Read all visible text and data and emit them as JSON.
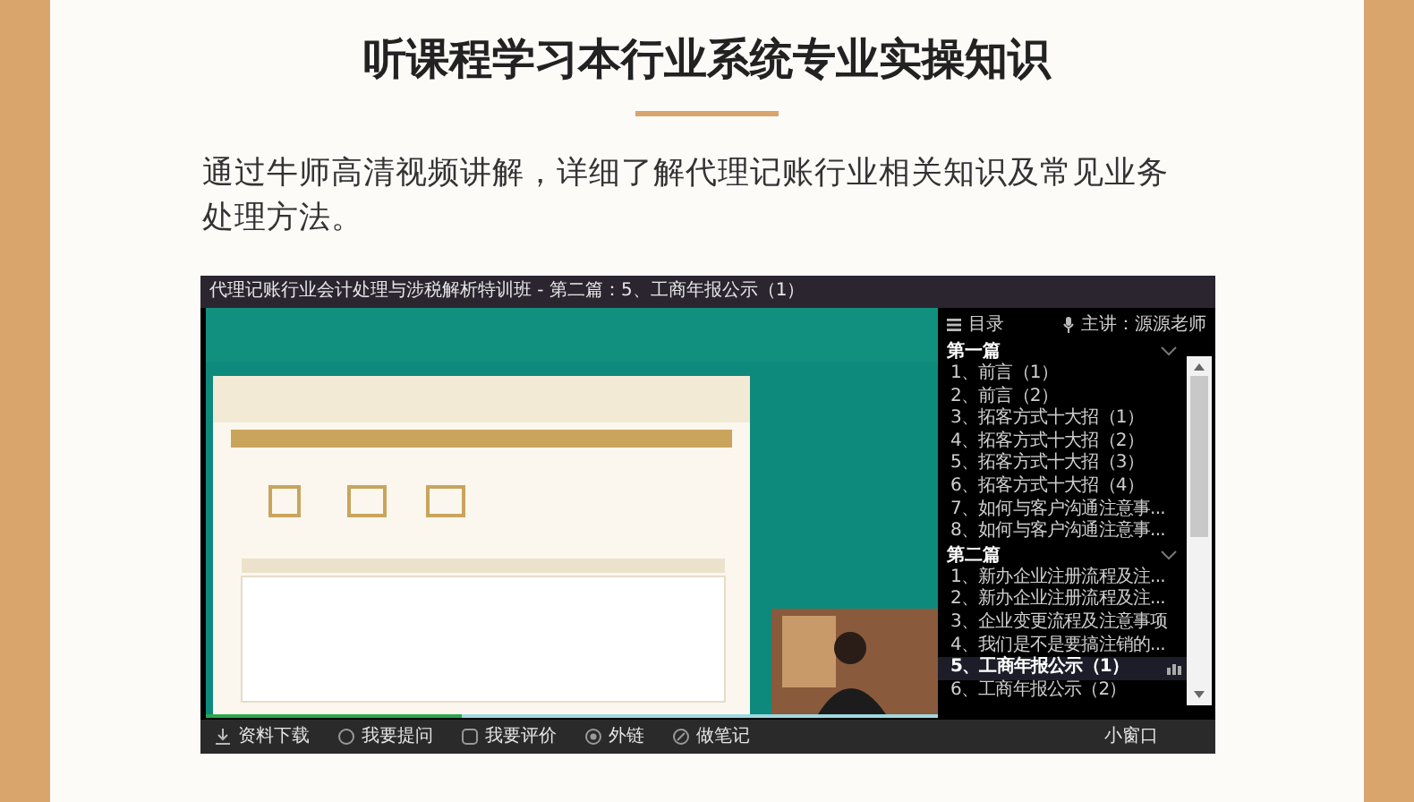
{
  "heading": "听课程学习本行业系统专业实操知识",
  "intro": "通过牛师高清视频讲解，详细了解代理记账行业相关知识及常见业务处理方法。",
  "player": {
    "title": "代理记账行业会计处理与涉税解析特训班 - 第二篇：5、工商年报公示（1）",
    "video": {
      "kind": "picture",
      "progress": {
        "level": 0.35
      }
    },
    "catalog_label": "目录",
    "lecturer": "主讲：源源老师",
    "sections": [
      {
        "title": "第一篇",
        "expanded": true,
        "lessons": [
          {
            "title": "1、前言（1）",
            "selected": false
          },
          {
            "title": "2、前言（2）",
            "selected": false
          },
          {
            "title": "3、拓客方式十大招（1）",
            "selected": false
          },
          {
            "title": "4、拓客方式十大招（2）",
            "selected": false
          },
          {
            "title": "5、拓客方式十大招（3）",
            "selected": false
          },
          {
            "title": "6、拓客方式十大招（4）",
            "selected": false
          },
          {
            "title": "7、如何与客户沟通注意事...",
            "selected": false
          },
          {
            "title": "8、如何与客户沟通注意事...",
            "selected": false
          }
        ]
      },
      {
        "title": "第二篇",
        "expanded": true,
        "lessons": [
          {
            "title": "1、新办企业注册流程及注...",
            "selected": false
          },
          {
            "title": "2、新办企业注册流程及注...",
            "selected": false
          },
          {
            "title": "3、企业变更流程及注意事项",
            "selected": false
          },
          {
            "title": "4、我们是不是要搞注销的...",
            "selected": false
          },
          {
            "title": "5、工商年报公示（1）",
            "selected": true
          },
          {
            "title": "6、工商年报公示（2）",
            "selected": false
          }
        ]
      }
    ],
    "toolbar": [
      {
        "label": "资料下载"
      },
      {
        "label": "我要提问"
      },
      {
        "label": "我要评价"
      },
      {
        "label": "外链"
      },
      {
        "label": "做笔记"
      }
    ],
    "mini_window": "小窗口"
  }
}
